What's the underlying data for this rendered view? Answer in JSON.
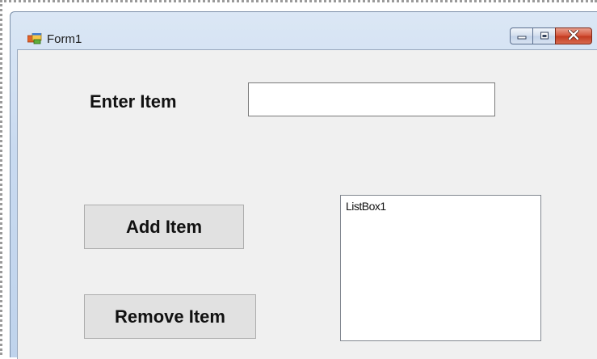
{
  "window": {
    "title": "Form1"
  },
  "form": {
    "enter_label": "Enter Item",
    "item_input_value": "",
    "add_button_label": "Add Item",
    "remove_button_label": "Remove Item",
    "listbox_items": [
      "ListBox1"
    ]
  },
  "colors": {
    "client_background": "#f0f0f0",
    "button_face": "#e1e1e1",
    "close_button": "#c8432a",
    "title_bar": "#c9daf0"
  }
}
